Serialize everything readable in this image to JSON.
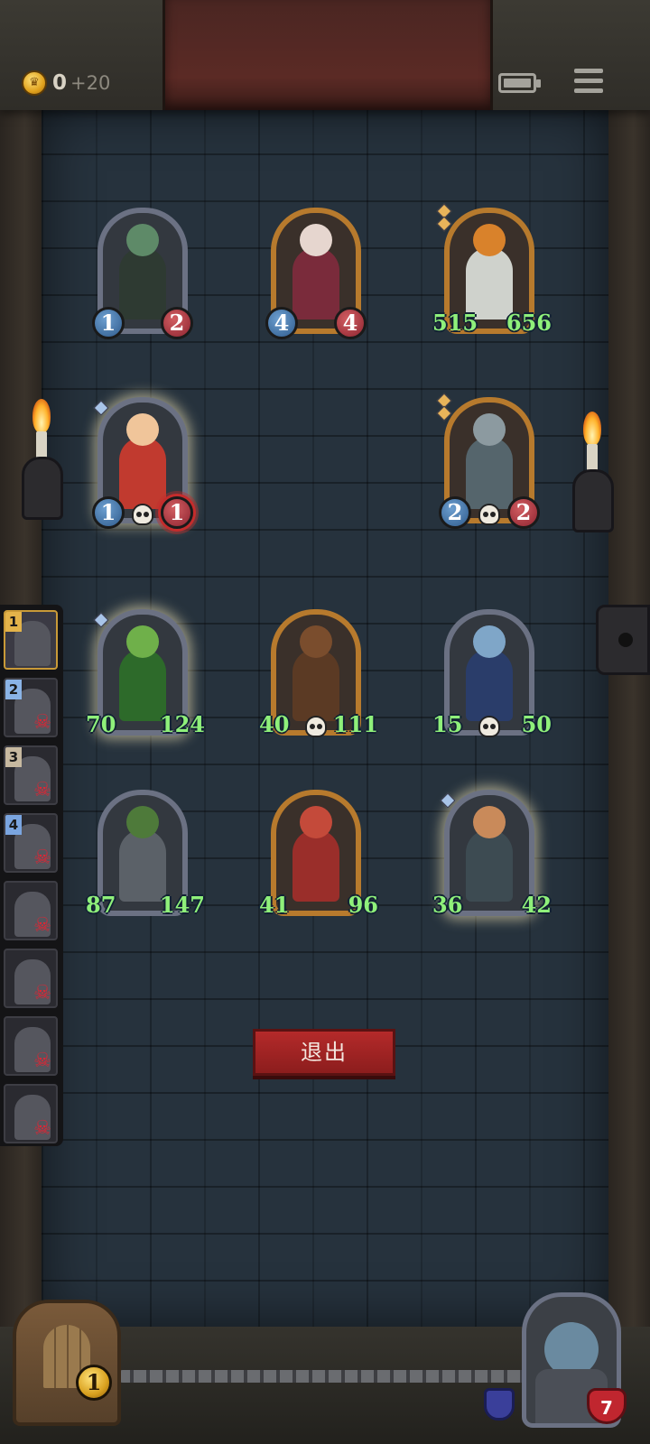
{
  "hud": {
    "coins": "0",
    "coin_bonus": "+20",
    "coin_icon": "crown-coin-icon",
    "battery_icon": "battery-icon",
    "menu_icon": "hamburger-menu-icon"
  },
  "board": {
    "rows": [
      [
        {
          "name": "spectral-skeleton",
          "attack": "1",
          "health": "2",
          "frame": "silver",
          "glow": false,
          "skull": false,
          "buffed": false
        },
        {
          "name": "jester-clown",
          "attack": "4",
          "health": "4",
          "frame": "gold",
          "glow": false,
          "skull": false,
          "buffed": false
        },
        {
          "name": "pumpkin-scarecrow",
          "attack": "515",
          "health": "656",
          "frame": "gold",
          "glow": false,
          "skull": false,
          "buffed": true
        }
      ],
      [
        {
          "name": "pinocchio-puppet",
          "attack": "1",
          "health": "1",
          "frame": "silver",
          "glow": true,
          "skull": true,
          "buffed": false,
          "targeted": true
        },
        {
          "name": "bell-automaton",
          "attack": "2",
          "health": "2",
          "frame": "gold",
          "glow": false,
          "skull": true,
          "buffed": false
        }
      ],
      [
        {
          "name": "leaf-dryad",
          "attack": "70",
          "health": "124",
          "frame": "silver",
          "glow": true,
          "skull": false,
          "buffed": true
        },
        {
          "name": "tiki-totem",
          "attack": "40",
          "health": "111",
          "frame": "gold",
          "glow": false,
          "skull": true,
          "buffed": true
        },
        {
          "name": "dark-elf-sorceress",
          "attack": "15",
          "health": "50",
          "frame": "silver",
          "glow": false,
          "skull": true,
          "buffed": true
        }
      ],
      [
        {
          "name": "moss-knight",
          "attack": "87",
          "health": "147",
          "frame": "silver",
          "glow": false,
          "skull": false,
          "buffed": true
        },
        {
          "name": "red-demon",
          "attack": "41",
          "health": "96",
          "frame": "gold",
          "glow": false,
          "skull": false,
          "buffed": true
        },
        {
          "name": "spear-child",
          "attack": "36",
          "health": "42",
          "frame": "silver",
          "glow": true,
          "skull": false,
          "buffed": true
        }
      ]
    ]
  },
  "roster": [
    {
      "number": "1",
      "dead": false,
      "active": true
    },
    {
      "number": "2",
      "dead": true,
      "active": false
    },
    {
      "number": "3",
      "dead": true,
      "active": false
    },
    {
      "number": "4",
      "dead": true,
      "active": false
    },
    {
      "number": "",
      "dead": true,
      "active": false
    },
    {
      "number": "",
      "dead": true,
      "active": false
    },
    {
      "number": "",
      "dead": true,
      "active": false
    },
    {
      "number": "",
      "dead": true,
      "active": false
    }
  ],
  "exit_button": "退出",
  "bottom": {
    "chest_count": "1",
    "hero_health": "7",
    "shield_icon": "shield-icon",
    "heart_icon": "heart-icon"
  },
  "colors": {
    "buffed_stat": "#8ff07a",
    "exit_button": "#b42a2a",
    "dungeon_wall": "#26323d"
  }
}
